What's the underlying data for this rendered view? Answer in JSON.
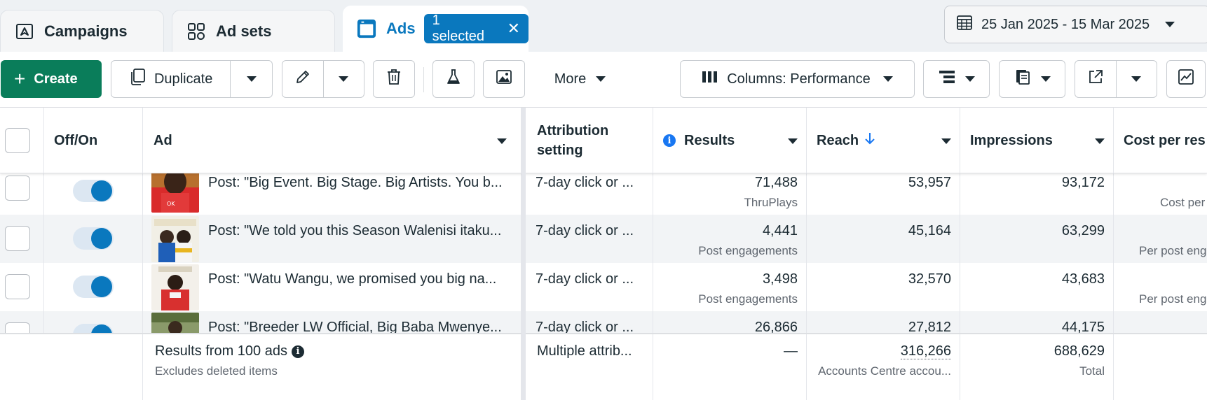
{
  "tabs": {
    "campaigns": "Campaigns",
    "ad_sets": "Ad sets",
    "ads": "Ads",
    "selected_pill": "1 selected",
    "clear_icon": "close-icon"
  },
  "date_range": "25 Jan 2025 - 15 Mar 2025",
  "toolbar": {
    "create": "Create",
    "duplicate": "Duplicate",
    "more": "More",
    "columns": "Columns: Performance"
  },
  "columns": {
    "toggle": "Off/On",
    "ad": "Ad",
    "attribution_line1": "Attribution",
    "attribution_line2": "setting",
    "results": "Results",
    "reach": "Reach",
    "impressions": "Impressions",
    "cost": "Cost per res"
  },
  "rows": [
    {
      "ad": "Post: \"Big Event. Big Stage. Big Artists. You b...",
      "attribution": "7-day click or ...",
      "results": "71,488",
      "results_type": "ThruPlays",
      "reach": "53,957",
      "impressions": "93,172",
      "cost_label": "Cost per",
      "on": true
    },
    {
      "ad": "Post: \"We told you this Season Walenisi itaku...",
      "attribution": "7-day click or ...",
      "results": "4,441",
      "results_type": "Post engagements",
      "reach": "45,164",
      "impressions": "63,299",
      "cost_label": "Per post eng",
      "on": true
    },
    {
      "ad": "Post: \"Watu Wangu, we promised you big na...",
      "attribution": "7-day click or ...",
      "results": "3,498",
      "results_type": "Post engagements",
      "reach": "32,570",
      "impressions": "43,683",
      "cost_label": "Per post eng",
      "on": true
    },
    {
      "ad": "Post: \"Breeder LW Official, Big Baba Mwenye...",
      "attribution": "7-day click or ...",
      "results": "26,866",
      "results_type": "",
      "reach": "27,812",
      "impressions": "44,175",
      "cost_label": "",
      "on": true
    }
  ],
  "footer": {
    "summary": "Results from 100 ads",
    "summary_sub": "Excludes deleted items",
    "attribution": "Multiple attrib...",
    "results": "—",
    "reach": "316,266",
    "reach_sub": "Accounts Centre accou...",
    "impressions": "688,629",
    "impressions_sub": "Total"
  },
  "colors": {
    "accent": "#0a78be",
    "create": "#0a7d5a",
    "info": "#1877f2"
  }
}
